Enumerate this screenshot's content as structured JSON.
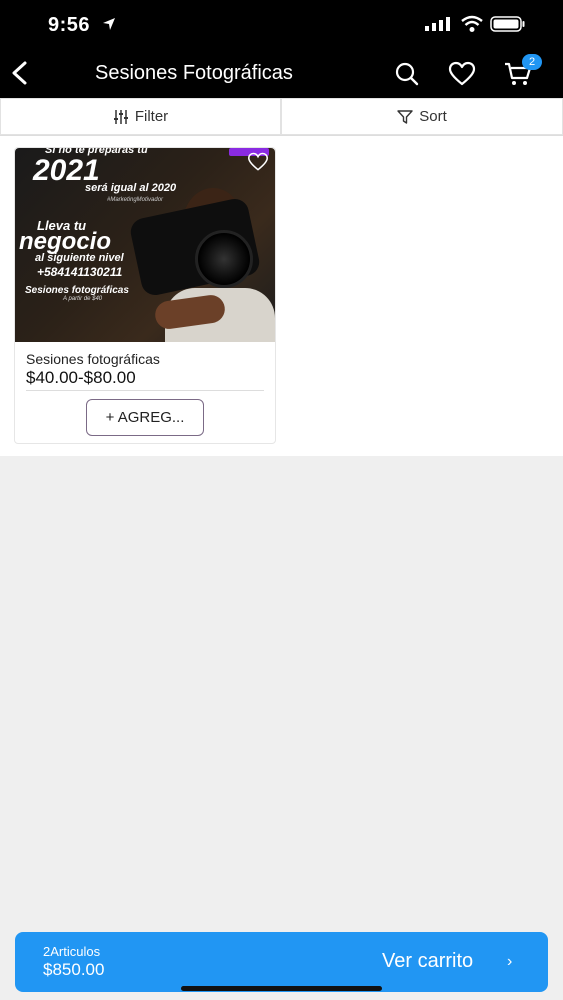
{
  "status_bar": {
    "time": "9:56"
  },
  "header": {
    "title": "Sesiones Fotográficas",
    "cart_count": "2"
  },
  "toolbar": {
    "filter_label": "Filter",
    "sort_label": "Sort"
  },
  "product": {
    "name": "Sesiones fotográficas",
    "price": "$40.00-$80.00",
    "add_label": "+ AGREG...",
    "image_text": {
      "top": "Si no te preparas tu",
      "year": "2021",
      "sub": "será igual al 2020",
      "sub2": "#MarketingMotivador",
      "lleva": "Lleva tu",
      "negocio": "negocio",
      "al_siguiente": "al siguiente nivel",
      "phone": "+584141130211",
      "sesiones": "Sesiones fotográficas",
      "partir": "A partir de $40"
    }
  },
  "cart_bar": {
    "count_label": "2Articulos",
    "total": "$850.00",
    "action_label": "Ver carrito",
    "chevron": "›"
  },
  "icons": [
    "location-arrow-icon",
    "signal-icon",
    "wifi-icon",
    "battery-icon",
    "back-icon",
    "search-icon",
    "heart-icon",
    "cart-icon",
    "filter-icon",
    "sort-icon",
    "wishlist-icon"
  ],
  "colors": {
    "header_bg": "#000000",
    "accent": "#2196f3",
    "badge": "#2196f3"
  }
}
